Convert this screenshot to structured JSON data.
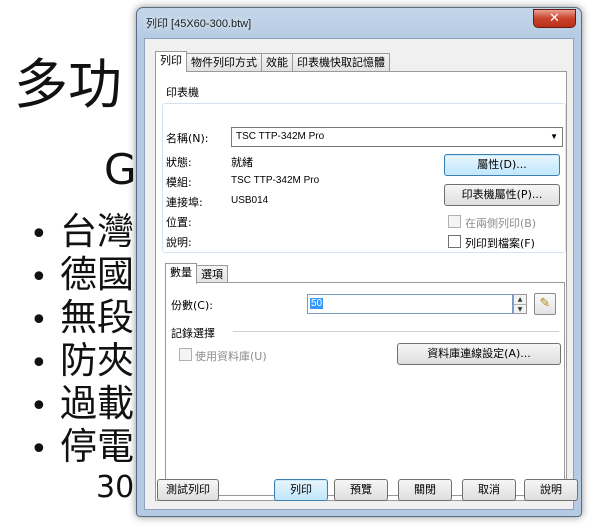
{
  "slide": {
    "title": "多功",
    "subtitle": "G",
    "bullets": [
      "台灣",
      "德國",
      "無段",
      "防夾",
      "過載",
      "停電"
    ],
    "bullet_glyph": "•",
    "bottom_text": "30"
  },
  "dialog": {
    "title": "列印 [45X60-300.btw]",
    "close_glyph": "✕",
    "tabs": [
      "列印",
      "物件列印方式",
      "效能",
      "印表機快取記憶體"
    ],
    "active_tab": "列印",
    "printer": {
      "group_label": "印表機",
      "name_label": "名稱(N):",
      "name_value": "TSC TTP-342M Pro",
      "status_label": "狀態:",
      "status_value": "就緒",
      "model_label": "模組:",
      "model_value": "TSC TTP-342M Pro",
      "port_label": "連接埠:",
      "port_value": "USB014",
      "location_label": "位置:",
      "comment_label": "說明:",
      "properties_button": "屬性(D)...",
      "printer_properties_button": "印表機屬性(P)...",
      "duplex_label": "在兩側列印(B)",
      "print_to_file_label": "列印到檔案(F)"
    },
    "sub_tabs": [
      "數量",
      "選項"
    ],
    "active_sub_tab": "數量",
    "quantity": {
      "copies_label": "份數(C):",
      "copies_value": "50",
      "spin_up": "▲",
      "spin_down": "▼",
      "pen_glyph": "✎",
      "record_selection_label": "記錄選擇",
      "use_database_label": "使用資料庫(U)",
      "db_connection_button": "資料庫連線設定(A)..."
    },
    "footer": {
      "test_print": "測試列印",
      "print": "列印",
      "preview": "預覽",
      "close": "關閉",
      "cancel": "取消",
      "help": "說明"
    },
    "colors": {
      "title_bar": "#b6cbe3",
      "close_button": "#c9422c",
      "selection": "#3399ff",
      "focused_button": "#bee6fd"
    }
  }
}
